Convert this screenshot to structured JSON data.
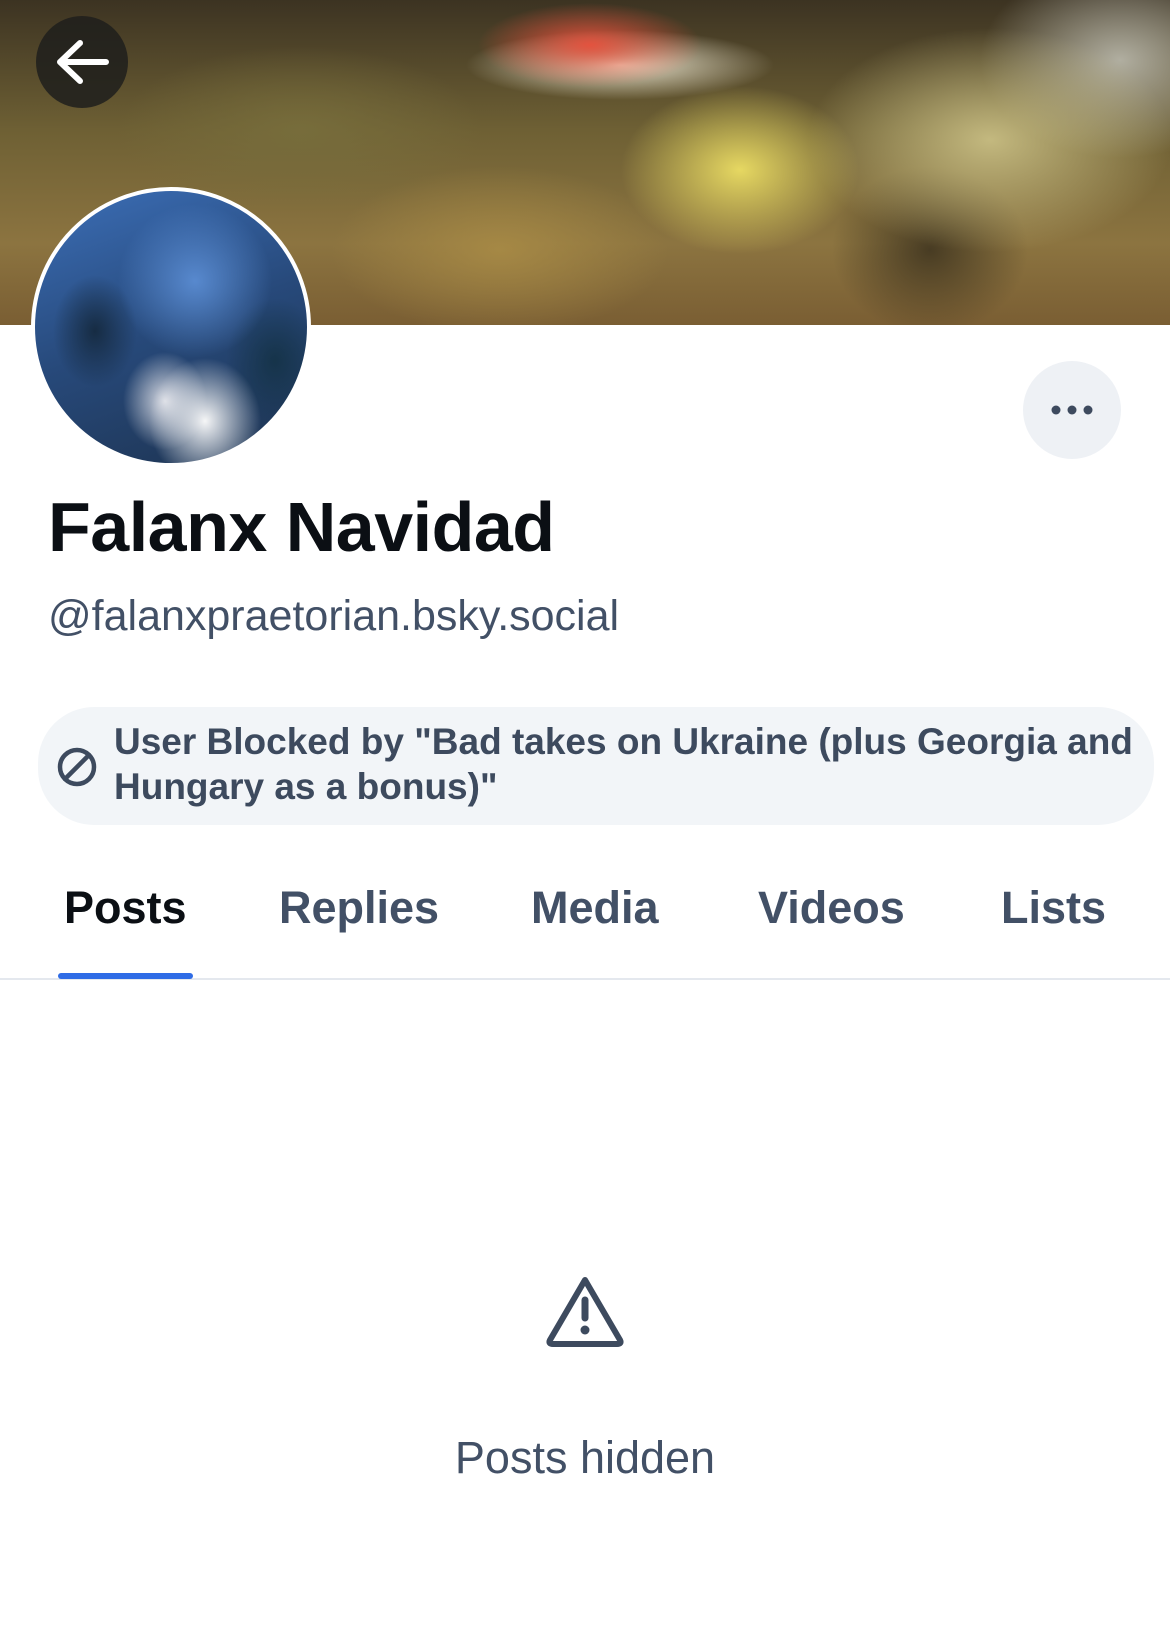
{
  "banner": {
    "back_icon": "arrow-left-icon"
  },
  "profile": {
    "display_name": "Falanx Navidad",
    "handle": "@falanxpraetorian.bsky.social",
    "more_icon": "ellipsis-icon"
  },
  "moderation": {
    "icon": "block-icon",
    "message": "User Blocked by \"Bad takes on Ukraine (plus Georgia and Hungary as a bonus)\""
  },
  "tabs": [
    {
      "label": "Posts",
      "active": true
    },
    {
      "label": "Replies",
      "active": false
    },
    {
      "label": "Media",
      "active": false
    },
    {
      "label": "Videos",
      "active": false
    },
    {
      "label": "Lists",
      "active": false
    }
  ],
  "empty_state": {
    "icon": "warning-icon",
    "message": "Posts hidden"
  },
  "colors": {
    "accent": "#2f6ce6",
    "text_primary": "#0b0f14",
    "text_secondary": "#425066",
    "surface": "#f2f5f8"
  }
}
